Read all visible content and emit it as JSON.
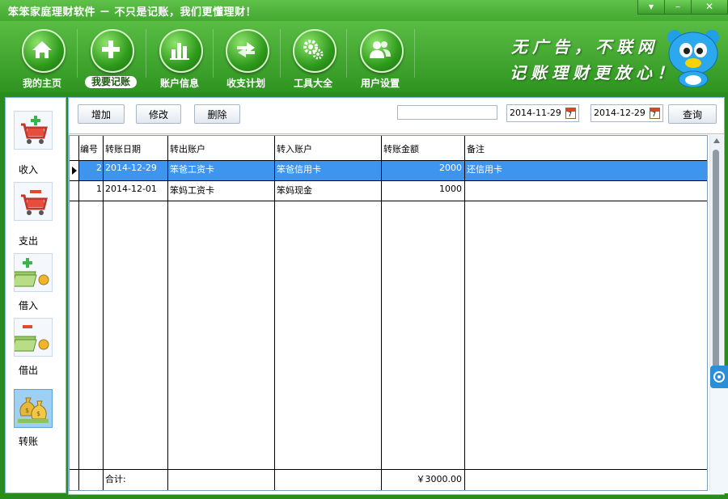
{
  "app": {
    "title": "笨笨家庭理财软件  － 不只是记账，我们更懂理财！",
    "window_controls": [
      "▾",
      "–",
      "✕"
    ]
  },
  "nav": {
    "items": [
      {
        "label": "我的主页",
        "icon": "home-icon"
      },
      {
        "label": "我要记账",
        "icon": "plus-icon",
        "active": true
      },
      {
        "label": "账户信息",
        "icon": "bar-chart-icon"
      },
      {
        "label": "收支计划",
        "icon": "transfer-arrows-icon"
      },
      {
        "label": "工具大全",
        "icon": "gears-icon"
      },
      {
        "label": "用户设置",
        "icon": "users-icon"
      }
    ]
  },
  "slogan": {
    "line1": "无广告，不联网",
    "line2": "记账理财更放心！"
  },
  "sidebar": {
    "items": [
      {
        "label": "收入",
        "icon": "cart-add-icon"
      },
      {
        "label": "支出",
        "icon": "cart-remove-icon"
      },
      {
        "label": "借入",
        "icon": "money-add-icon"
      },
      {
        "label": "借出",
        "icon": "money-remove-icon"
      },
      {
        "label": "转账",
        "icon": "money-bags-icon",
        "active": true
      }
    ]
  },
  "toolbar": {
    "add_label": "增加",
    "edit_label": "修改",
    "delete_label": "删除",
    "search_value": "",
    "date_from": "2014-11-29",
    "date_to": "2014-12-29",
    "query_label": "查询",
    "calendar_digit": "7"
  },
  "table": {
    "columns": [
      "编号",
      "转账日期",
      "转出账户",
      "转入账户",
      "转账金额",
      "备注"
    ],
    "rows": [
      {
        "id": "2",
        "date": "2014-12-29",
        "from": "笨爸工资卡",
        "to": "笨爸信用卡",
        "amount": "2000",
        "note": "还信用卡",
        "selected": true
      },
      {
        "id": "1",
        "date": "2014-12-01",
        "from": "笨妈工资卡",
        "to": "笨妈现金",
        "amount": "1000",
        "note": ""
      }
    ],
    "footer": {
      "label": "合计:",
      "total": "￥3000.00"
    }
  },
  "colors": {
    "accent_green": "#2f9420",
    "selection_blue": "#3d95ef"
  }
}
